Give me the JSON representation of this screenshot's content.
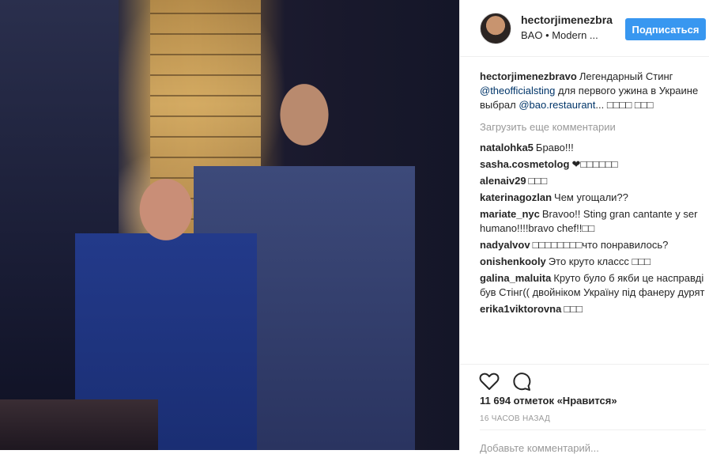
{
  "post": {
    "username": "hectorjimenezbra",
    "location": "BAO • Modern ...",
    "follow_label": "Подписаться",
    "caption": {
      "user": "hectorjimenezbravo",
      "text_before": "Легендарный Стинг ",
      "mention1": "@theofficialsting",
      "text_middle": " для первого ужина в Украине выбрал ",
      "mention2": "@bao.restaurant",
      "text_after": "... □□□□ □□□"
    },
    "load_more": "Загрузить еще комментарии",
    "comments": [
      {
        "user": "natalohka5",
        "text": "Браво!!!"
      },
      {
        "user": "sasha.cosmetolog",
        "text": "❤□□□□□□"
      },
      {
        "user": "alenaiv29",
        "text": "□□□"
      },
      {
        "user": "katerinagozlan",
        "text": "Чем угощали??"
      },
      {
        "user": "mariate_nyc",
        "text": "Bravoo!! Sting gran cantante y ser humano!!!!bravo chef!!□□"
      },
      {
        "user": "nadyalvov",
        "text": "□□□□□□□□что понравилось?"
      },
      {
        "user": "onishenkooly",
        "text": "Это круто классс □□□"
      },
      {
        "user": "galina_maluita",
        "text": "Круто було б якби це насправді був Стінг(( двойніком Україну під фанеру дурят"
      },
      {
        "user": "erika1viktorovna",
        "text": "□□□"
      }
    ],
    "likes": "11 694 отметок «Нравится»",
    "time": "16 ЧАСОВ НАЗАД",
    "add_comment": "Добавьте комментарий..."
  },
  "icons": {
    "like": "heart-icon",
    "comment": "comment-bubble-icon"
  },
  "colors": {
    "accent": "#3897f0",
    "mention": "#003569",
    "muted": "#999999"
  }
}
